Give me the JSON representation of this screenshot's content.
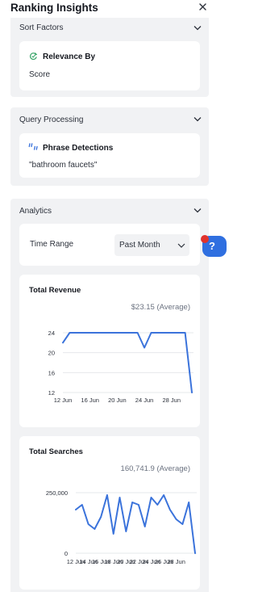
{
  "panel": {
    "title": "Ranking Insights"
  },
  "sections": {
    "sort_factors": {
      "label": "Sort Factors",
      "card_title": "Relevance By",
      "card_value": "Score"
    },
    "query_processing": {
      "label": "Query Processing",
      "card_title": "Phrase Detections",
      "card_value": "\"bathroom faucets\""
    },
    "analytics": {
      "label": "Analytics",
      "time_range_label": "Time Range",
      "time_range_value": "Past Month"
    }
  },
  "charts": {
    "revenue": {
      "title": "Total Revenue",
      "average": "$23.15 (Average)"
    },
    "searches": {
      "title": "Total Searches",
      "average": "160,741.9 (Average)"
    }
  },
  "help": {
    "label": "?"
  },
  "colors": {
    "accent": "#3b73db",
    "panel_bg": "#f1f2f4",
    "help_bg": "#2f6fe0",
    "badge": "#e0322b",
    "check": "#3aa66a"
  },
  "chart_data": [
    {
      "type": "line",
      "title": "Total Revenue",
      "xlabel": "",
      "ylabel": "",
      "x_ticks": [
        "12 Jun",
        "16 Jun",
        "20 Jun",
        "24 Jun",
        "28 Jun"
      ],
      "y_ticks": [
        12,
        16,
        20,
        24
      ],
      "ylim": [
        12,
        24
      ],
      "grid": true,
      "x": [
        "2024-06-12",
        "2024-06-13",
        "2024-06-14",
        "2024-06-15",
        "2024-06-16",
        "2024-06-17",
        "2024-06-18",
        "2024-06-19",
        "2024-06-20",
        "2024-06-21",
        "2024-06-22",
        "2024-06-23",
        "2024-06-24",
        "2024-06-25",
        "2024-06-26",
        "2024-06-27",
        "2024-06-28",
        "2024-06-29",
        "2024-06-30",
        "2024-07-01"
      ],
      "values": [
        22,
        24,
        24,
        24,
        24,
        24,
        24,
        24,
        24,
        24,
        24,
        24,
        21,
        24,
        24,
        24,
        24,
        24,
        24,
        12
      ]
    },
    {
      "type": "line",
      "title": "Total Searches",
      "xlabel": "",
      "ylabel": "",
      "x_ticks": [
        "12 Jun",
        "14 Jun",
        "16 Jun",
        "18 Jun",
        "20 Jun",
        "22 Jun",
        "24 Jun",
        "26 Jun",
        "28 Jun"
      ],
      "y_ticks": [
        0,
        250000
      ],
      "ylim": [
        0,
        250000
      ],
      "grid": true,
      "x": [
        "2024-06-12",
        "2024-06-13",
        "2024-06-14",
        "2024-06-15",
        "2024-06-16",
        "2024-06-17",
        "2024-06-18",
        "2024-06-19",
        "2024-06-20",
        "2024-06-21",
        "2024-06-22",
        "2024-06-23",
        "2024-06-24",
        "2024-06-25",
        "2024-06-26",
        "2024-06-27",
        "2024-06-28",
        "2024-06-29",
        "2024-06-30",
        "2024-07-01"
      ],
      "values": [
        180000,
        200000,
        120000,
        100000,
        150000,
        240000,
        80000,
        230000,
        90000,
        210000,
        200000,
        110000,
        230000,
        200000,
        240000,
        180000,
        140000,
        120000,
        210000,
        0
      ]
    }
  ]
}
